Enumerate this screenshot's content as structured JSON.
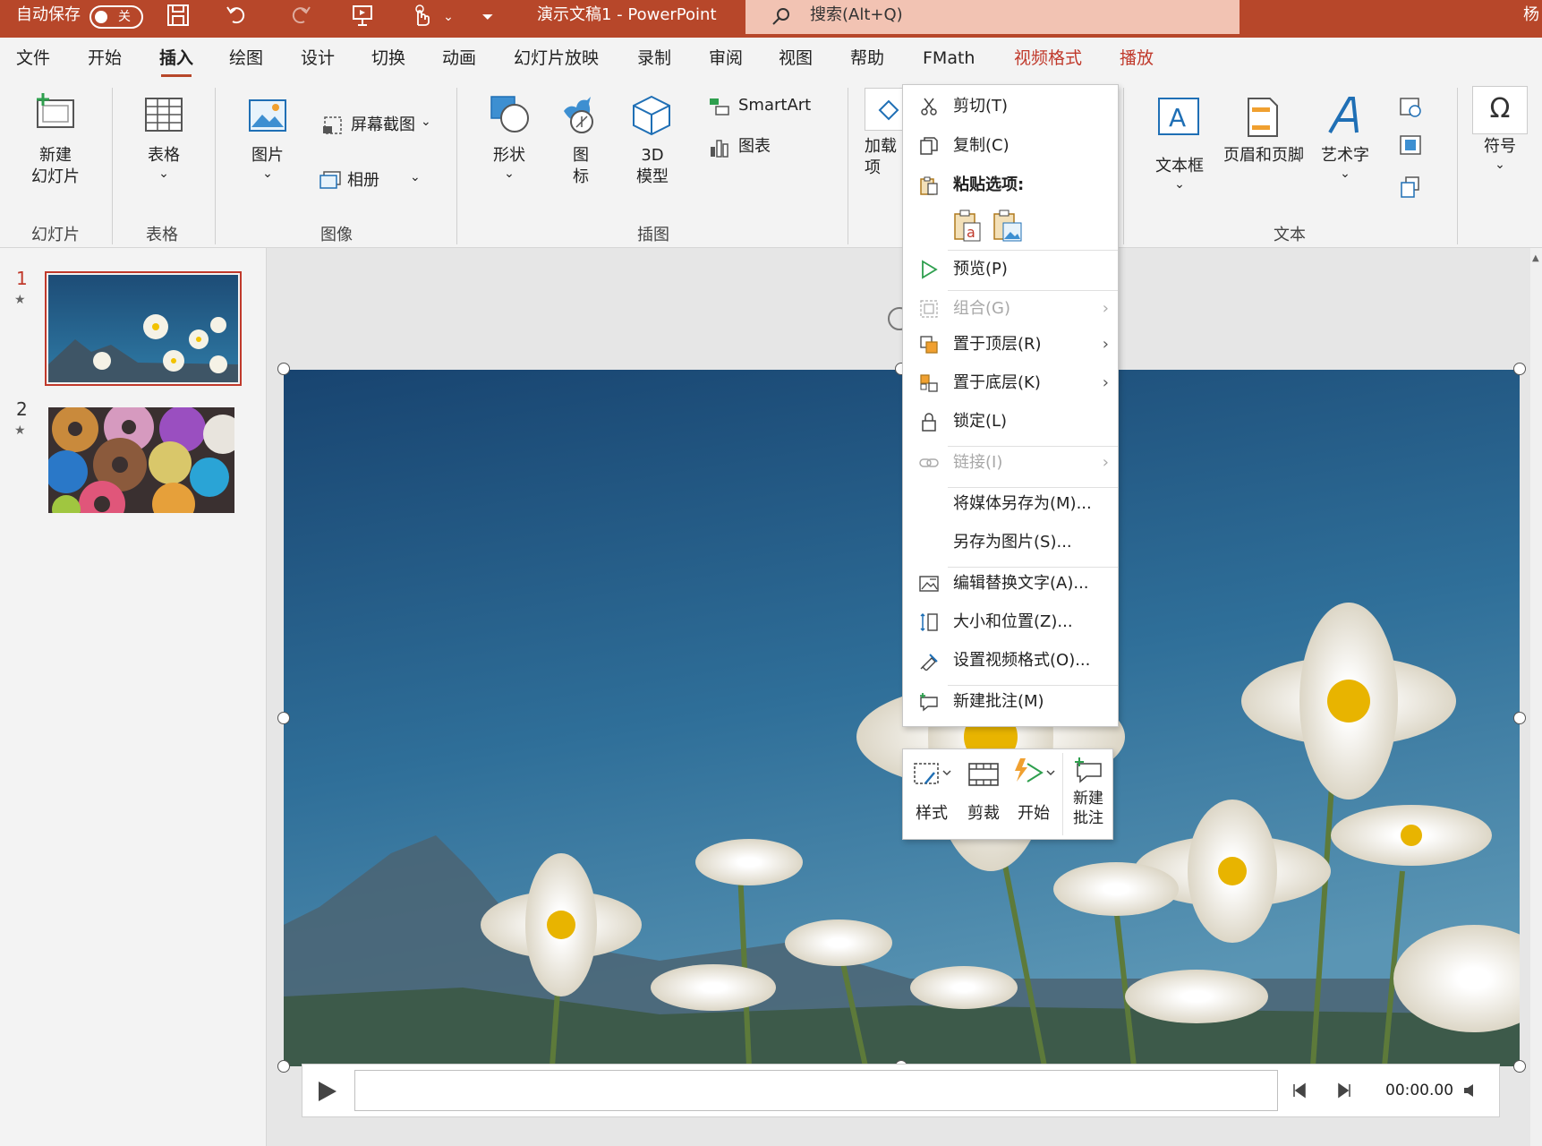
{
  "titlebar": {
    "autosave_label": "自动保存",
    "autosave_state": "关",
    "doc_title": "演示文稿1  -  PowerPoint",
    "search_placeholder": "搜索(Alt+Q)",
    "user_initial": "杨",
    "icons": [
      "save-icon",
      "undo-icon",
      "redo-icon",
      "present-icon",
      "touch-mode-icon",
      "customize-qat-icon"
    ]
  },
  "tabs": [
    "文件",
    "开始",
    "插入",
    "绘图",
    "设计",
    "切换",
    "动画",
    "幻灯片放映",
    "录制",
    "审阅",
    "视图",
    "帮助",
    "FMath",
    "视频格式",
    "播放"
  ],
  "active_tab": "插入",
  "ribbon": {
    "new_slide": "新建\n幻灯片",
    "table": "表格",
    "picture": "图片",
    "screenshot": "屏幕截图",
    "album": "相册",
    "shapes": "形状",
    "icons": "图\n标",
    "model3d": "3D\n模型",
    "smartart": "SmartArt",
    "chart": "图表",
    "addins": "加载\n项",
    "textbox": "文本框",
    "header_footer": "页眉和页脚",
    "wordart": "艺术字",
    "symbol": "符号",
    "groups": {
      "slides": "幻灯片",
      "tables": "表格",
      "images": "图像",
      "illustrations": "插图",
      "text": "文本"
    }
  },
  "slides": [
    {
      "number": "1",
      "thumb": "daisies"
    },
    {
      "number": "2",
      "thumb": "donuts"
    }
  ],
  "context_menu": {
    "cut": "剪切(T)",
    "copy": "复制(C)",
    "paste_options": "粘贴选项:",
    "preview": "预览(P)",
    "group": "组合(G)",
    "bring_front": "置于顶层(R)",
    "send_back": "置于底层(K)",
    "lock": "锁定(L)",
    "link": "链接(I)",
    "save_media": "将媒体另存为(M)...",
    "save_picture": "另存为图片(S)...",
    "alt_text": "编辑替换文字(A)...",
    "size_position": "大小和位置(Z)...",
    "format_video": "设置视频格式(O)...",
    "new_comment": "新建批注(M)"
  },
  "mini_toolbar": {
    "style": "样式",
    "trim": "剪裁",
    "start": "开始",
    "new_comment": "新建\n批注"
  },
  "player": {
    "time": "00:00.00"
  },
  "colors": {
    "brand": "#b7472a",
    "search_bg": "#f2c3b3",
    "context_tab": "#c0392b"
  }
}
